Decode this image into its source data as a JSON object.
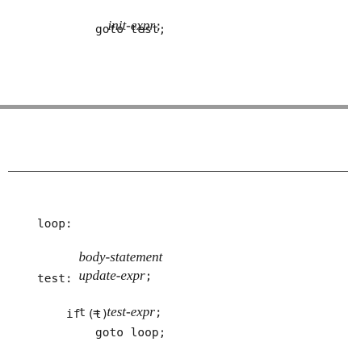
{
  "top_block": {
    "init_expr": "init-expr",
    "init_semicolon": ";",
    "goto_test": "goto test;"
  },
  "bottom_block": {
    "loop_label": "loop:",
    "body_statement": "body-statement",
    "update_expr": "update-expr",
    "update_semicolon": ";",
    "test_label": "test:",
    "t_assign_prefix": "t = ",
    "test_expr": "test-expr",
    "test_semicolon": ";",
    "if_line": "if (t)",
    "goto_loop": "goto loop;"
  },
  "colors": {
    "text": "#1a1a1a",
    "thick_rule": "#9a9a9a",
    "thin_rule": "#444444"
  }
}
